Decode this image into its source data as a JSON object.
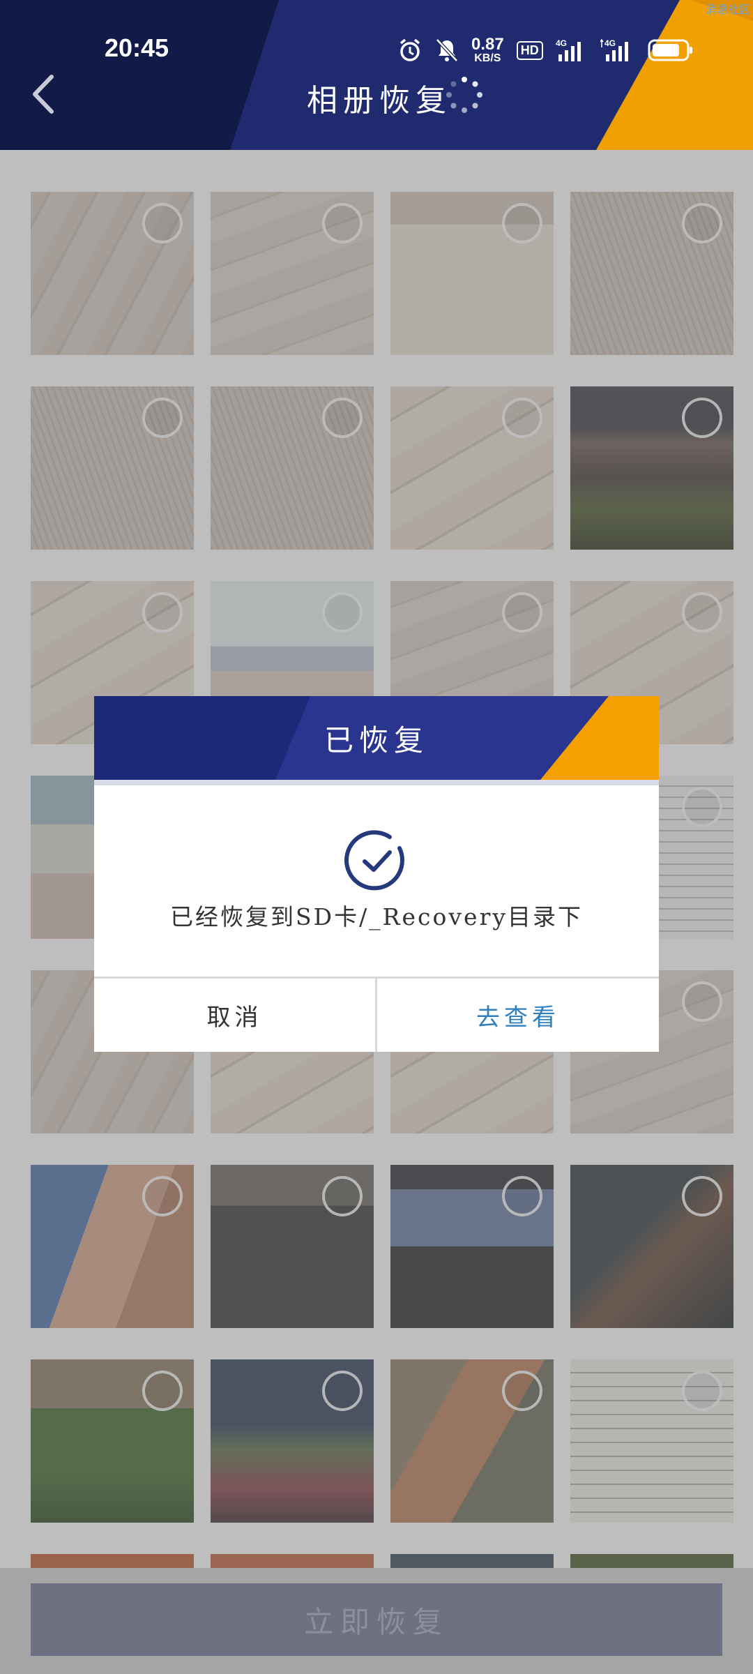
{
  "status_bar": {
    "time": "20:45",
    "net_speed_value": "0.87",
    "net_speed_unit": "KB/S",
    "hd_label": "HD",
    "signal1_label": "4G",
    "signal2_label": "4G",
    "corner_text": "消息社区"
  },
  "header": {
    "title": "相册恢复",
    "colors": {
      "navy": "#1a2454",
      "accent": "#f0a000"
    }
  },
  "grid": {
    "items": [
      {
        "pattern": "p-floor"
      },
      {
        "pattern": "p-floor2"
      },
      {
        "pattern": "p-court"
      },
      {
        "pattern": "p-grain"
      },
      {
        "pattern": "p-grain"
      },
      {
        "pattern": "p-grain"
      },
      {
        "pattern": "p-plank"
      },
      {
        "pattern": "p-storm"
      },
      {
        "pattern": "p-plank"
      },
      {
        "pattern": "p-gym"
      },
      {
        "pattern": "p-floor2"
      },
      {
        "pattern": "p-plank"
      },
      {
        "pattern": "p-gym2"
      },
      {
        "pattern": "p-floor"
      },
      {
        "pattern": "p-floor2"
      },
      {
        "pattern": "p-doc"
      },
      {
        "pattern": "p-floor"
      },
      {
        "pattern": "p-plank"
      },
      {
        "pattern": "p-plank"
      },
      {
        "pattern": "p-floor2"
      },
      {
        "pattern": "p-people"
      },
      {
        "pattern": "p-keys"
      },
      {
        "pattern": "p-laptop"
      },
      {
        "pattern": "p-dark"
      },
      {
        "pattern": "p-plants"
      },
      {
        "pattern": "p-sky"
      },
      {
        "pattern": "p-cows"
      },
      {
        "pattern": "p-paper"
      }
    ]
  },
  "dialog": {
    "title": "已恢复",
    "message": "已经恢复到SD卡/_Recovery目录下",
    "cancel_label": "取消",
    "view_label": "去查看",
    "colors": {
      "header": "#242e7e",
      "accent": "#f5a000",
      "link": "#2f7fbf"
    }
  },
  "bottom": {
    "restore_label": "立即恢复"
  }
}
